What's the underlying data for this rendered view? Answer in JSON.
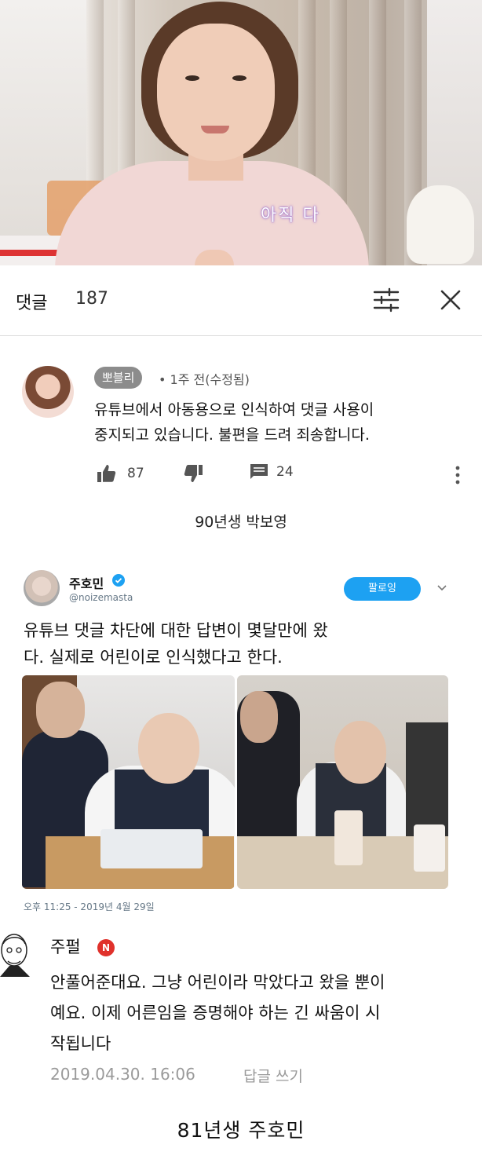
{
  "video": {
    "subtitle": "아직 다"
  },
  "comments_header": {
    "title": "댓글",
    "count": "187",
    "sort_icon": "sort-filter-icon",
    "close_icon": "close-icon"
  },
  "youtube_comment": {
    "author": "뽀블리",
    "meta": "• 1주 전(수정됨)",
    "text_line1": "유튜브에서 아동용으로 인식하여 댓글 사용이",
    "text_line2": "중지되고 있습니다. 불편을 드려 죄송합니다.",
    "likes": "87",
    "replies": "24",
    "icons": [
      "thumbs-up-icon",
      "thumbs-down-icon",
      "reply-icon",
      "more-vertical-icon"
    ]
  },
  "caption1": "90년생 박보영",
  "tweet": {
    "name": "주호민",
    "handle": "@noizemasta",
    "follow_label": "팔로잉",
    "text_line1": "유튜브 댓글 차단에 대한 답변이 몇달만에 왔",
    "text_line2": "다. 실제로 어린이로 인식했다고 한다.",
    "date": "오후 11:25 - 2019년 4월 29일",
    "accent": "#1da1f2"
  },
  "naver_comment": {
    "name": "주펄",
    "badge": "N",
    "text_line1": "안풀어준대요. 그냥 어린이라 막았다고 왔을 뿐이",
    "text_line2": "예요. 이제 어른임을 증명해야 하는 긴 싸움이 시",
    "text_line3": "작됩니다",
    "date": "2019.04.30. 16:06",
    "reply_label": "답글 쓰기",
    "badge_color": "#e0312b"
  },
  "caption2": "81년생 주호민"
}
